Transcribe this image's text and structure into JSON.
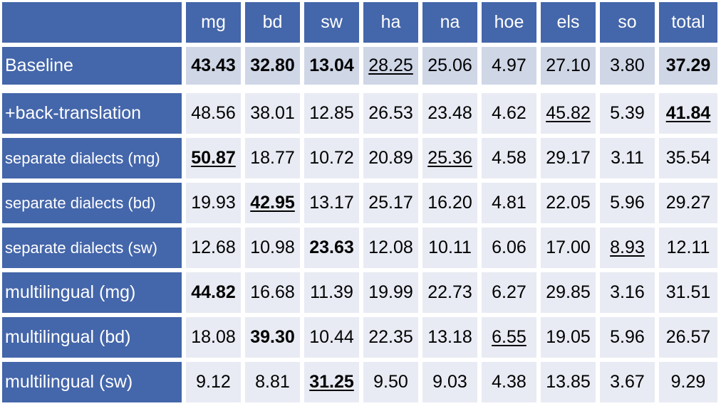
{
  "table": {
    "columns": [
      "mg",
      "bd",
      "sw",
      "ha",
      "na",
      "hoe",
      "els",
      "so",
      "total"
    ],
    "rows": [
      {
        "label": "Baseline",
        "small": false,
        "cells": [
          {
            "v": "43.43",
            "b": true,
            "u": false
          },
          {
            "v": "32.80",
            "b": true,
            "u": false
          },
          {
            "v": "13.04",
            "b": true,
            "u": false
          },
          {
            "v": "28.25",
            "b": false,
            "u": true
          },
          {
            "v": "25.06",
            "b": false,
            "u": false
          },
          {
            "v": "4.97",
            "b": false,
            "u": false
          },
          {
            "v": "27.10",
            "b": false,
            "u": false
          },
          {
            "v": "3.80",
            "b": false,
            "u": false
          },
          {
            "v": "37.29",
            "b": true,
            "u": false
          }
        ]
      },
      {
        "label": "+back-translation",
        "small": false,
        "cells": [
          {
            "v": "48.56",
            "b": false,
            "u": false
          },
          {
            "v": "38.01",
            "b": false,
            "u": false
          },
          {
            "v": "12.85",
            "b": false,
            "u": false
          },
          {
            "v": "26.53",
            "b": false,
            "u": false
          },
          {
            "v": "23.48",
            "b": false,
            "u": false
          },
          {
            "v": "4.62",
            "b": false,
            "u": false
          },
          {
            "v": "45.82",
            "b": false,
            "u": true
          },
          {
            "v": "5.39",
            "b": false,
            "u": false
          },
          {
            "v": "41.84",
            "b": true,
            "u": true
          }
        ]
      },
      {
        "label": "separate dialects (mg)",
        "small": true,
        "cells": [
          {
            "v": "50.87",
            "b": true,
            "u": true
          },
          {
            "v": "18.77",
            "b": false,
            "u": false
          },
          {
            "v": "10.72",
            "b": false,
            "u": false
          },
          {
            "v": "20.89",
            "b": false,
            "u": false
          },
          {
            "v": "25.36",
            "b": false,
            "u": true
          },
          {
            "v": "4.58",
            "b": false,
            "u": false
          },
          {
            "v": "29.17",
            "b": false,
            "u": false
          },
          {
            "v": "3.11",
            "b": false,
            "u": false
          },
          {
            "v": "35.54",
            "b": false,
            "u": false
          }
        ]
      },
      {
        "label": "separate dialects  (bd)",
        "small": true,
        "cells": [
          {
            "v": "19.93",
            "b": false,
            "u": false
          },
          {
            "v": "42.95",
            "b": true,
            "u": true
          },
          {
            "v": "13.17",
            "b": false,
            "u": false
          },
          {
            "v": "25.17",
            "b": false,
            "u": false
          },
          {
            "v": "16.20",
            "b": false,
            "u": false
          },
          {
            "v": "4.81",
            "b": false,
            "u": false
          },
          {
            "v": "22.05",
            "b": false,
            "u": false
          },
          {
            "v": "5.96",
            "b": false,
            "u": false
          },
          {
            "v": "29.27",
            "b": false,
            "u": false
          }
        ]
      },
      {
        "label": "separate dialects (sw)",
        "small": true,
        "cells": [
          {
            "v": "12.68",
            "b": false,
            "u": false
          },
          {
            "v": "10.98",
            "b": false,
            "u": false
          },
          {
            "v": "23.63",
            "b": true,
            "u": false
          },
          {
            "v": "12.08",
            "b": false,
            "u": false
          },
          {
            "v": "10.11",
            "b": false,
            "u": false
          },
          {
            "v": "6.06",
            "b": false,
            "u": false
          },
          {
            "v": "17.00",
            "b": false,
            "u": false
          },
          {
            "v": "8.93",
            "b": false,
            "u": true
          },
          {
            "v": "12.11",
            "b": false,
            "u": false
          }
        ]
      },
      {
        "label": "multilingual (mg)",
        "small": false,
        "cells": [
          {
            "v": "44.82",
            "b": true,
            "u": false
          },
          {
            "v": "16.68",
            "b": false,
            "u": false
          },
          {
            "v": "11.39",
            "b": false,
            "u": false
          },
          {
            "v": "19.99",
            "b": false,
            "u": false
          },
          {
            "v": "22.73",
            "b": false,
            "u": false
          },
          {
            "v": "6.27",
            "b": false,
            "u": false
          },
          {
            "v": "29.85",
            "b": false,
            "u": false
          },
          {
            "v": "3.16",
            "b": false,
            "u": false
          },
          {
            "v": "31.51",
            "b": false,
            "u": false
          }
        ]
      },
      {
        "label": "multilingual (bd)",
        "small": false,
        "cells": [
          {
            "v": "18.08",
            "b": false,
            "u": false
          },
          {
            "v": "39.30",
            "b": true,
            "u": false
          },
          {
            "v": "10.44",
            "b": false,
            "u": false
          },
          {
            "v": "22.35",
            "b": false,
            "u": false
          },
          {
            "v": "13.18",
            "b": false,
            "u": false
          },
          {
            "v": "6.55",
            "b": false,
            "u": true
          },
          {
            "v": "19.05",
            "b": false,
            "u": false
          },
          {
            "v": "5.96",
            "b": false,
            "u": false
          },
          {
            "v": "26.57",
            "b": false,
            "u": false
          }
        ]
      },
      {
        "label": "multilingual (sw)",
        "small": false,
        "cells": [
          {
            "v": "9.12",
            "b": false,
            "u": false
          },
          {
            "v": "8.81",
            "b": false,
            "u": false
          },
          {
            "v": "31.25",
            "b": true,
            "u": true
          },
          {
            "v": "9.50",
            "b": false,
            "u": false
          },
          {
            "v": "9.03",
            "b": false,
            "u": false
          },
          {
            "v": "4.38",
            "b": false,
            "u": false
          },
          {
            "v": "13.85",
            "b": false,
            "u": false
          },
          {
            "v": "3.67",
            "b": false,
            "u": false
          },
          {
            "v": "9.29",
            "b": false,
            "u": false
          }
        ]
      }
    ]
  }
}
